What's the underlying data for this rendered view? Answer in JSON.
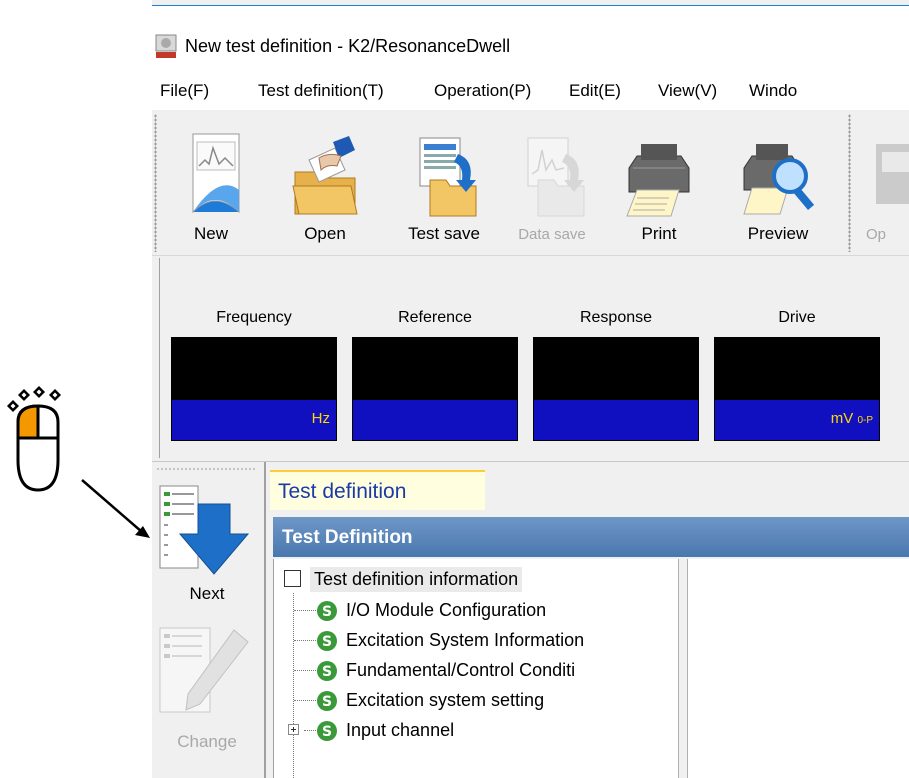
{
  "window": {
    "title": "New test definition - K2/ResonanceDwell"
  },
  "menu": {
    "items": [
      "File(F)",
      "Test definition(T)",
      "Operation(P)",
      "Edit(E)",
      "View(V)",
      "Windo"
    ]
  },
  "toolbar": {
    "new_label": "New",
    "open_label": "Open",
    "test_save_label": "Test save",
    "data_save_label": "Data save",
    "print_label": "Print",
    "preview_label": "Preview",
    "op_label": "Op"
  },
  "meters": [
    {
      "label": "Frequency",
      "unit": "Hz",
      "sub": ""
    },
    {
      "label": "Reference",
      "unit": "",
      "sub": ""
    },
    {
      "label": "Response",
      "unit": "",
      "sub": ""
    },
    {
      "label": "Drive",
      "unit": "mV",
      "sub": "0-P"
    }
  ],
  "side": {
    "next_label": "Next",
    "change_label": "Change"
  },
  "tab": {
    "label": "Test definition"
  },
  "panel": {
    "title": "Test Definition"
  },
  "tree": {
    "root": "Test definition information",
    "items": [
      "I/O Module Configuration",
      "Excitation System Information",
      "Fundamental/Control Conditi",
      "Excitation system setting",
      "Input channel"
    ]
  },
  "colors": {
    "meter_unit_bg": "#1010c0",
    "meter_unit_text": "#ffd700",
    "tab_text": "#1a3aa8",
    "panel_title_bg": "#5a86bb",
    "accent_orange": "#f39800"
  },
  "icons": {
    "overlay": "mouse-left-click-icon",
    "side_next": "next-arrow-icon",
    "side_change": "change-pencil-icon",
    "tree_item": "s-badge-icon"
  }
}
